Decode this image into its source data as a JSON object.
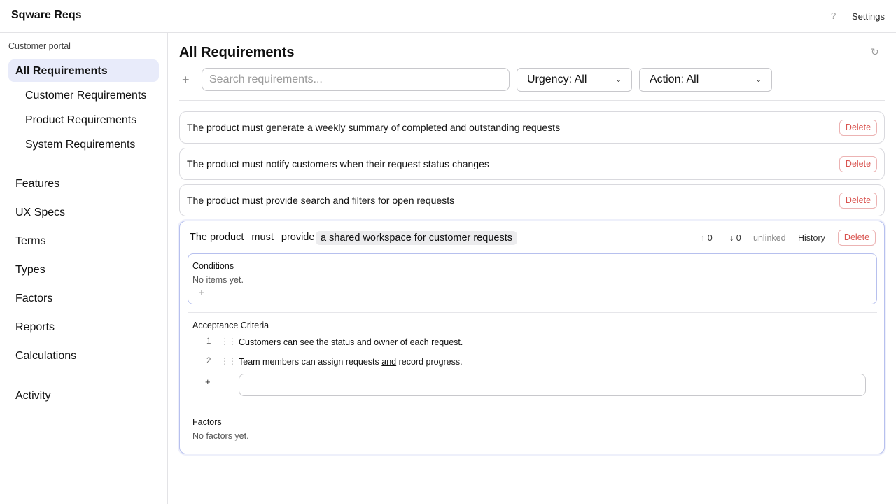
{
  "app": {
    "title": "Sqware Reqs"
  },
  "header": {
    "help_label": "?",
    "settings_label": "Settings"
  },
  "sidebar": {
    "project": "Customer portal",
    "items": [
      {
        "label": "All Requirements"
      },
      {
        "label": "Customer Requirements"
      },
      {
        "label": "Product Requirements"
      },
      {
        "label": "System Requirements"
      },
      {
        "label": "Features"
      },
      {
        "label": "UX Specs"
      },
      {
        "label": "Terms"
      },
      {
        "label": "Types"
      },
      {
        "label": "Factors"
      },
      {
        "label": "Reports"
      },
      {
        "label": "Calculations"
      },
      {
        "label": "Activity"
      }
    ]
  },
  "main": {
    "title": "All Requirements",
    "refresh_icon": "↻",
    "add_icon": "+",
    "search": {
      "placeholder": "Search requirements...",
      "value": ""
    },
    "filters": {
      "urgency": "Urgency: All",
      "action": "Action: All"
    },
    "requirements": [
      {
        "text": "The product must generate a weekly summary of completed and outstanding requests",
        "delete_label": "Delete"
      },
      {
        "text": "The product must notify customers when their request status changes",
        "delete_label": "Delete"
      },
      {
        "text": "The product must provide search and filters for open requests",
        "delete_label": "Delete"
      }
    ],
    "expanded": {
      "subject": "The product",
      "modal": "must",
      "verb": "provide",
      "object": "a shared workspace for customer requests",
      "upvotes": "↑ 0",
      "downvotes": "↓ 0",
      "link_status": "unlinked",
      "history_label": "History",
      "delete_label": "Delete",
      "conditions": {
        "label": "Conditions",
        "empty": "No items yet.",
        "add_icon": "+"
      },
      "acceptance": {
        "label": "Acceptance Criteria",
        "items": [
          {
            "num": "1",
            "pre": "Customers can see the status ",
            "conj": "and",
            "post": " owner of each request."
          },
          {
            "num": "2",
            "pre": "Team members can assign requests ",
            "conj": "and",
            "post": " record progress."
          }
        ],
        "add_icon": "+",
        "new_value": ""
      },
      "factors": {
        "label": "Factors",
        "empty": "No factors yet."
      }
    }
  }
}
